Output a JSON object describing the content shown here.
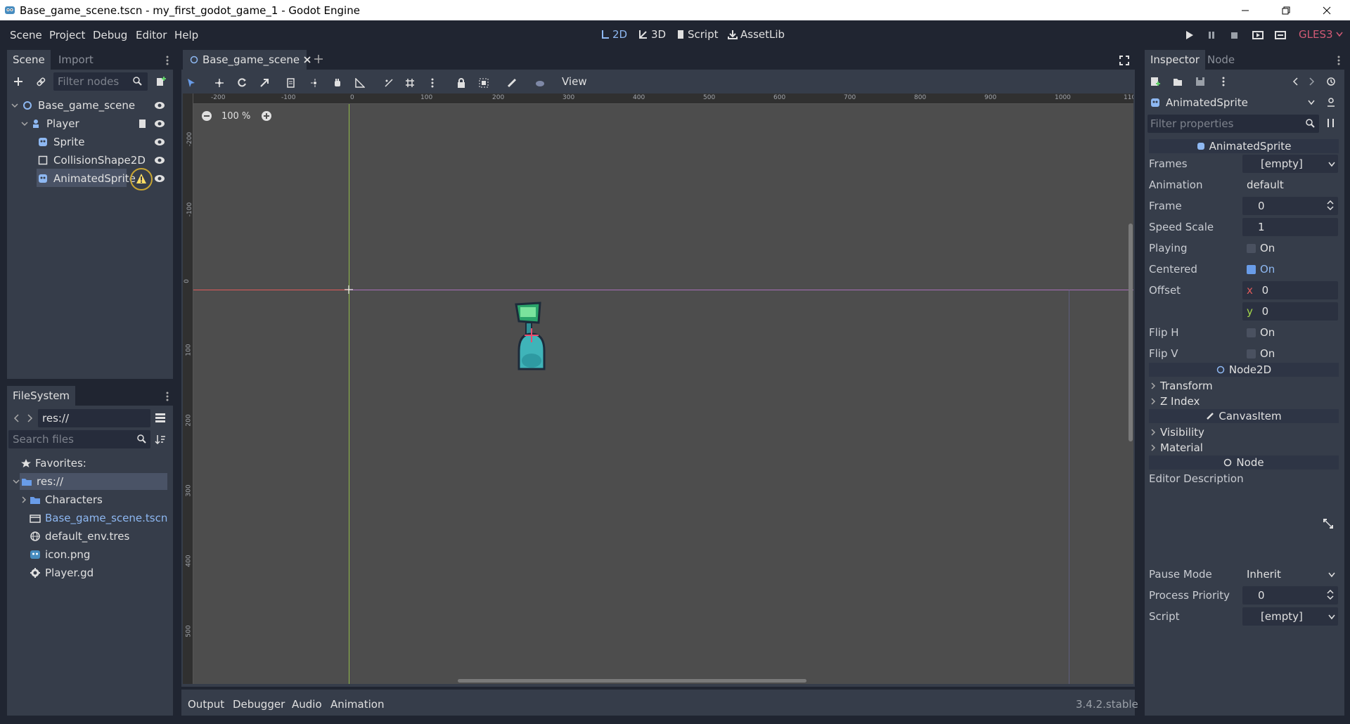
{
  "window": {
    "title": "Base_game_scene.tscn - my_first_godot_game_1 - Godot Engine"
  },
  "menu": [
    "Scene",
    "Project",
    "Debug",
    "Editor",
    "Help"
  ],
  "workspaces": {
    "two_d": "2D",
    "three_d": "3D",
    "script": "Script",
    "assetlib": "AssetLib"
  },
  "renderer": "GLES3",
  "scene_dock": {
    "tab_scene": "Scene",
    "tab_import": "Import",
    "filter_placeholder": "Filter nodes",
    "nodes": [
      {
        "name": "Base_game_scene"
      },
      {
        "name": "Player"
      },
      {
        "name": "Sprite"
      },
      {
        "name": "CollisionShape2D"
      },
      {
        "name": "AnimatedSprite"
      }
    ]
  },
  "filesystem": {
    "tab": "FileSystem",
    "path": "res://",
    "search_placeholder": "Search files",
    "favorites": "Favorites:",
    "items": [
      {
        "name": "res://"
      },
      {
        "name": "Characters"
      },
      {
        "name": "Base_game_scene.tscn"
      },
      {
        "name": "default_env.tres"
      },
      {
        "name": "icon.png"
      },
      {
        "name": "Player.gd"
      }
    ]
  },
  "editor": {
    "scene_tab": "Base_game_scene",
    "view_menu": "View",
    "zoom": "100 %",
    "ruler_h": [
      "-200",
      "-100",
      "0",
      "100",
      "200",
      "300",
      "400",
      "500",
      "600",
      "700",
      "800",
      "900",
      "1000",
      "110"
    ],
    "ruler_v": [
      "-200",
      "-100",
      "0",
      "100",
      "200",
      "300",
      "400",
      "500"
    ]
  },
  "bottom": {
    "tabs": [
      "Output",
      "Debugger",
      "Audio",
      "Animation"
    ],
    "version": "3.4.2.stable"
  },
  "inspector": {
    "tab_inspector": "Inspector",
    "tab_node": "Node",
    "object": "AnimatedSprite",
    "filter_placeholder": "Filter properties",
    "class_header": "AnimatedSprite",
    "props": {
      "frames_label": "Frames",
      "frames_val": "[empty]",
      "animation_label": "Animation",
      "animation_val": "default",
      "frame_label": "Frame",
      "frame_val": "0",
      "speed_label": "Speed Scale",
      "speed_val": "1",
      "playing_label": "Playing",
      "playing_val": "On",
      "centered_label": "Centered",
      "centered_val": "On",
      "offset_label": "Offset",
      "offset_x_axis": "x",
      "offset_x": "0",
      "offset_y_axis": "y",
      "offset_y": "0",
      "fliph_label": "Flip H",
      "fliph_val": "On",
      "flipv_label": "Flip V",
      "flipv_val": "On"
    },
    "node2d_header": "Node2D",
    "transform": "Transform",
    "zindex": "Z Index",
    "canvasitem_header": "CanvasItem",
    "visibility": "Visibility",
    "material": "Material",
    "node_header": "Node",
    "editor_desc": "Editor Description",
    "pause_label": "Pause Mode",
    "pause_val": "Inherit",
    "priority_label": "Process Priority",
    "priority_val": "0",
    "script_label": "Script",
    "script_val": "[empty]"
  },
  "colors": {
    "accent": "#699ce8",
    "warning": "#ffdd65",
    "renderer": "#d25a75",
    "x_axis": "#e25a5a",
    "y_axis": "#a4d64a"
  }
}
